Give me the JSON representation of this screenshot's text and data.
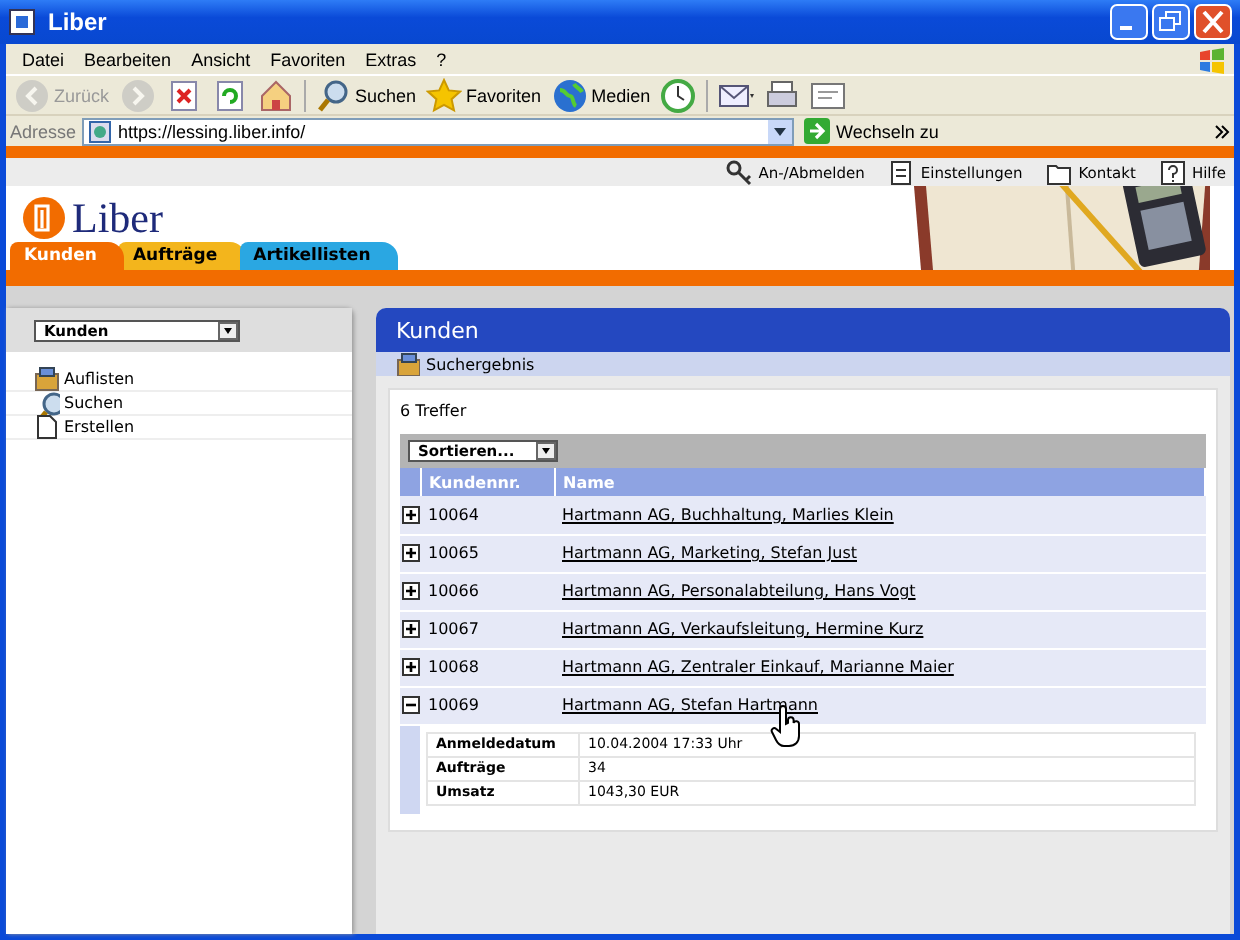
{
  "window": {
    "title": "Liber"
  },
  "menu": [
    "Datei",
    "Bearbeiten",
    "Ansicht",
    "Favoriten",
    "Extras",
    "?"
  ],
  "toolbar": [
    {
      "kind": "back",
      "label": "Zurück",
      "disabled": true
    },
    {
      "kind": "forward",
      "disabled": true
    },
    {
      "kind": "stop",
      "disabled": false
    },
    {
      "kind": "refresh",
      "disabled": false
    },
    {
      "kind": "home",
      "disabled": false
    },
    {
      "kind": "search",
      "label": "Suchen",
      "disabled": false
    },
    {
      "kind": "favorites",
      "label": "Favoriten",
      "disabled": false
    },
    {
      "kind": "media",
      "label": "Medien",
      "disabled": false
    },
    {
      "kind": "history",
      "disabled": false
    },
    {
      "kind": "mail",
      "disabled": false
    },
    {
      "kind": "print",
      "disabled": false
    },
    {
      "kind": "edit",
      "disabled": false
    }
  ],
  "address": {
    "label": "Adresse",
    "value": "https://lessing.liber.info/",
    "go": "Wechseln zu"
  },
  "top_links": [
    {
      "kind": "key",
      "label": "An-/Abmelden"
    },
    {
      "kind": "settings",
      "label": "Einstellungen"
    },
    {
      "kind": "contact",
      "label": "Kontakt"
    },
    {
      "kind": "help",
      "label": "Hilfe"
    }
  ],
  "logo": "Liber",
  "tabs": [
    {
      "label": "Kunden",
      "selected": true,
      "color": "#f26c00"
    },
    {
      "label": "Aufträge",
      "selected": false,
      "color": "#f3b51c"
    },
    {
      "label": "Artikellisten",
      "selected": false,
      "color": "#2aa7e2"
    }
  ],
  "sidebar": {
    "select": "Kunden",
    "items": [
      {
        "kind": "list",
        "label": "Auflisten"
      },
      {
        "kind": "search",
        "label": "Suchen"
      },
      {
        "kind": "new",
        "label": "Erstellen"
      }
    ]
  },
  "panel": {
    "title": "Kunden",
    "breadcrumb": "Suchergebnis",
    "count": "6 Treffer",
    "sort": "Sortieren...",
    "columns": [
      "Kundennr.",
      "Name"
    ],
    "rows": [
      {
        "id": "10064",
        "name": "Hartmann AG, Buchhaltung, Marlies Klein",
        "expanded": false
      },
      {
        "id": "10065",
        "name": "Hartmann AG, Marketing, Stefan Just",
        "expanded": false
      },
      {
        "id": "10066",
        "name": "Hartmann AG, Personalabteilung, Hans Vogt",
        "expanded": false
      },
      {
        "id": "10067",
        "name": "Hartmann AG, Verkaufsleitung, Hermine Kurz",
        "expanded": false
      },
      {
        "id": "10068",
        "name": "Hartmann AG, Zentraler Einkauf, Marianne Maier",
        "expanded": false
      },
      {
        "id": "10069",
        "name": "Hartmann AG, Stefan Hartmann",
        "expanded": true,
        "details": [
          {
            "label": "Anmeldedatum",
            "value": "10.04.2004  17:33 Uhr"
          },
          {
            "label": "Aufträge",
            "value": "34"
          },
          {
            "label": "Umsatz",
            "value": "1043,30 EUR"
          }
        ]
      }
    ]
  }
}
